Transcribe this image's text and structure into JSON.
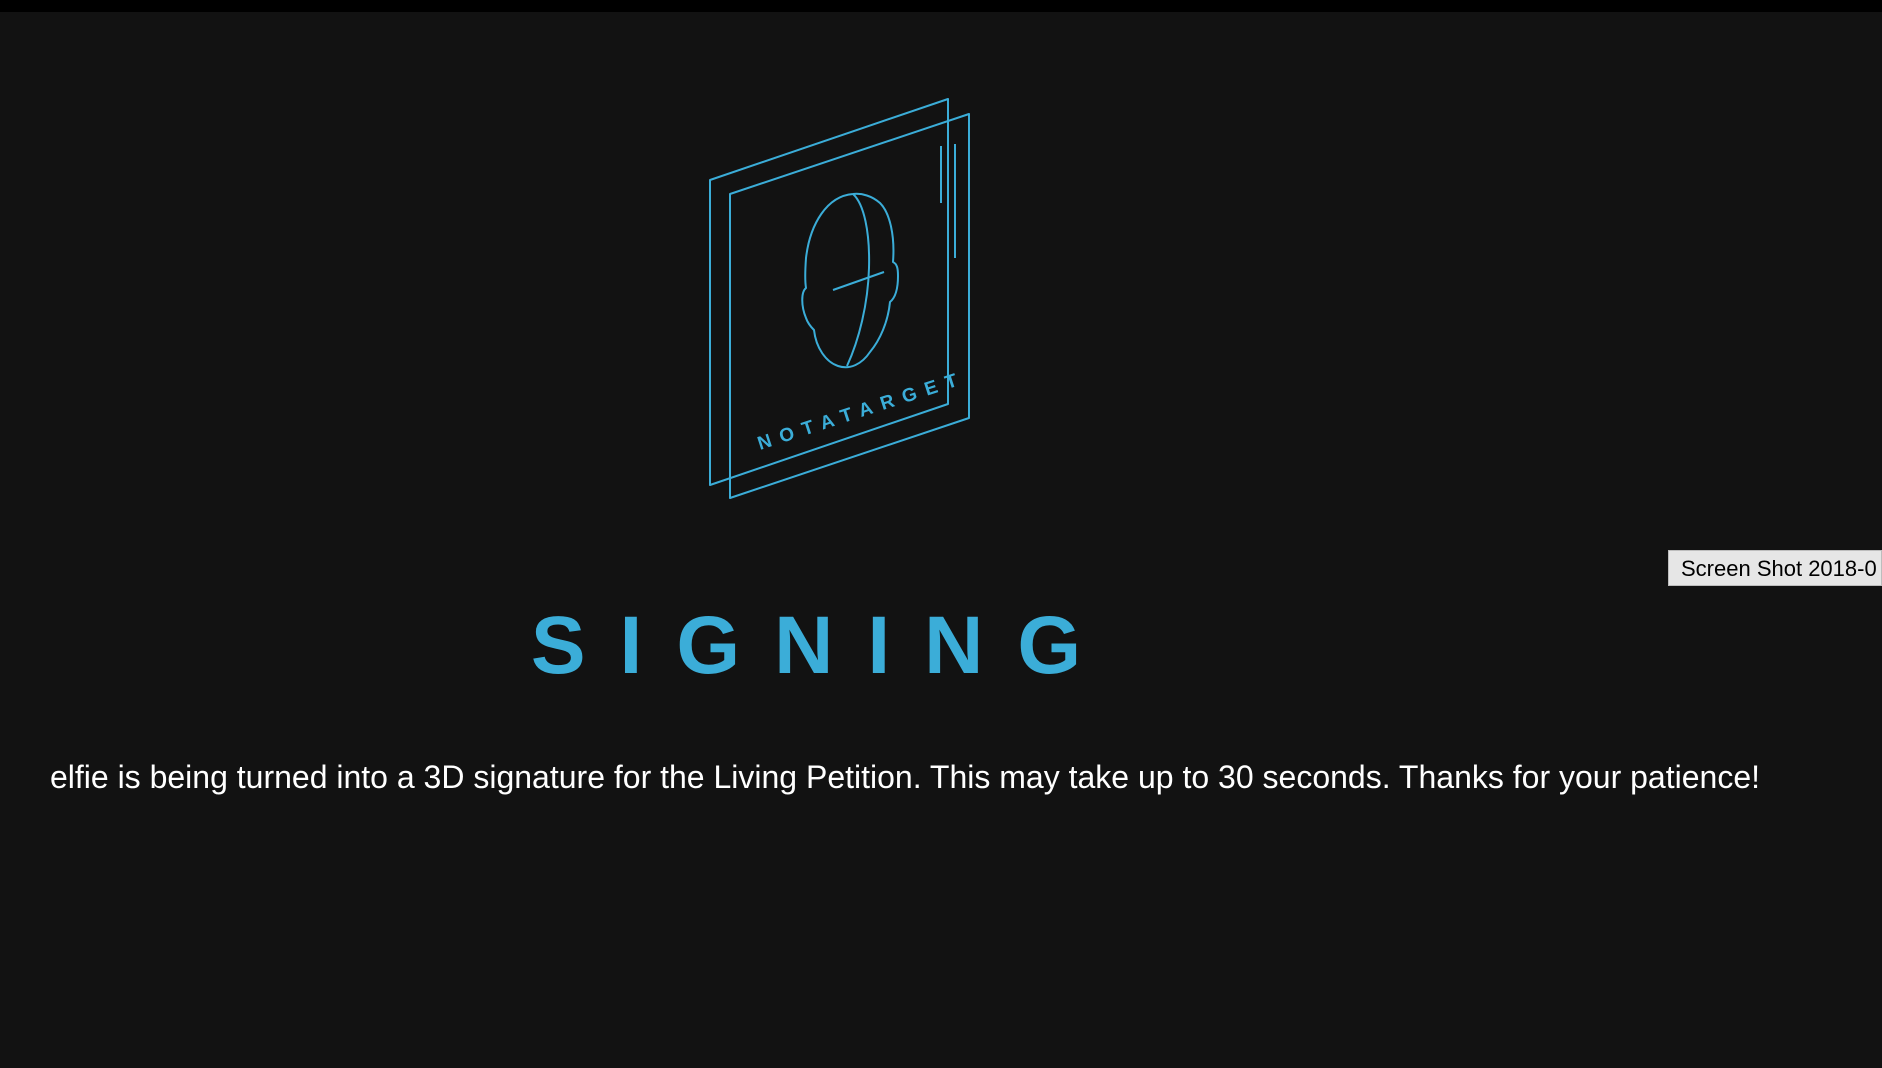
{
  "logo": {
    "icon": "notatarget-face-logo-icon",
    "wordmark": "NOTATARGET",
    "accent_color": "#3badd8"
  },
  "status": {
    "title": "SIGNING",
    "message": "elfie is being turned into a 3D signature for the Living Petition. This may take up to 30 seconds. Thanks for your patience!"
  },
  "tooltip": {
    "text": "Screen Shot 2018-0"
  },
  "colors": {
    "background": "#121212",
    "top_bar": "#000000",
    "accent": "#3badd8",
    "text": "#ffffff",
    "tooltip_bg": "#e6e6e6"
  }
}
